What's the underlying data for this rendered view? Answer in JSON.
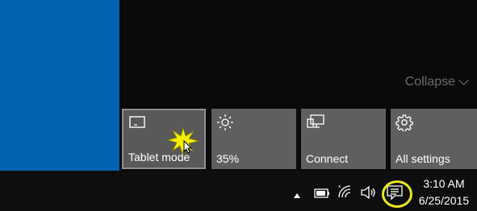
{
  "action_center": {
    "collapse_label": "Collapse",
    "tiles": [
      {
        "label": "Tablet mode",
        "icon": "tablet-mode-icon"
      },
      {
        "label": "35%",
        "icon": "brightness-icon"
      },
      {
        "label": "Connect",
        "icon": "connect-icon"
      },
      {
        "label": "All settings",
        "icon": "settings-gear-icon"
      }
    ]
  },
  "taskbar": {
    "time": "3:10 AM",
    "date": "6/25/2015",
    "tray_icons": [
      "show-hidden-icons-icon",
      "battery-icon",
      "wifi-icon",
      "volume-icon",
      "action-center-icon"
    ]
  },
  "colors": {
    "desktop": "#0063b1",
    "tile": "#5f5f5f",
    "highlight": "#e8e824"
  }
}
